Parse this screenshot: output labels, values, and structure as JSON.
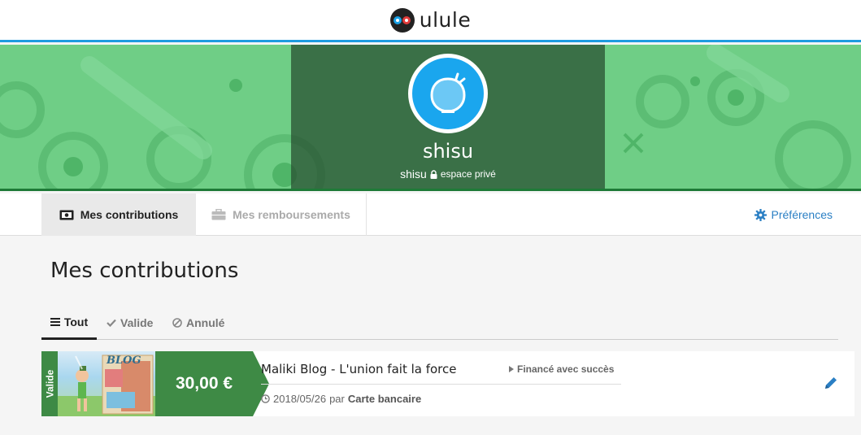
{
  "header": {
    "logo_text": "ulule"
  },
  "profile": {
    "username": "shisu",
    "handle": "shisu",
    "privacy_label": "espace privé"
  },
  "tabs": [
    {
      "label": "Mes contributions",
      "active": true
    },
    {
      "label": "Mes remboursements",
      "active": false
    }
  ],
  "preferences_label": "Préférences",
  "page_title": "Mes contributions",
  "filters": [
    {
      "label": "Tout",
      "icon": "list-icon",
      "active": true
    },
    {
      "label": "Valide",
      "icon": "check-icon",
      "active": false
    },
    {
      "label": "Annulé",
      "icon": "ban-icon",
      "active": false
    }
  ],
  "contribution": {
    "status": "Valide",
    "amount": "30,00 €",
    "project_title": "Maliki Blog - L'union fait la force",
    "project_status": "Financé avec succès",
    "date": "2018/05/26",
    "by_label": "par",
    "payment_method": "Carte bancaire",
    "thumb_text": "BLOG"
  },
  "colors": {
    "accent_blue": "#1e9be0",
    "banner_green": "#6fce86",
    "success_green": "#3e8a45",
    "link_blue": "#2a7fc4"
  }
}
